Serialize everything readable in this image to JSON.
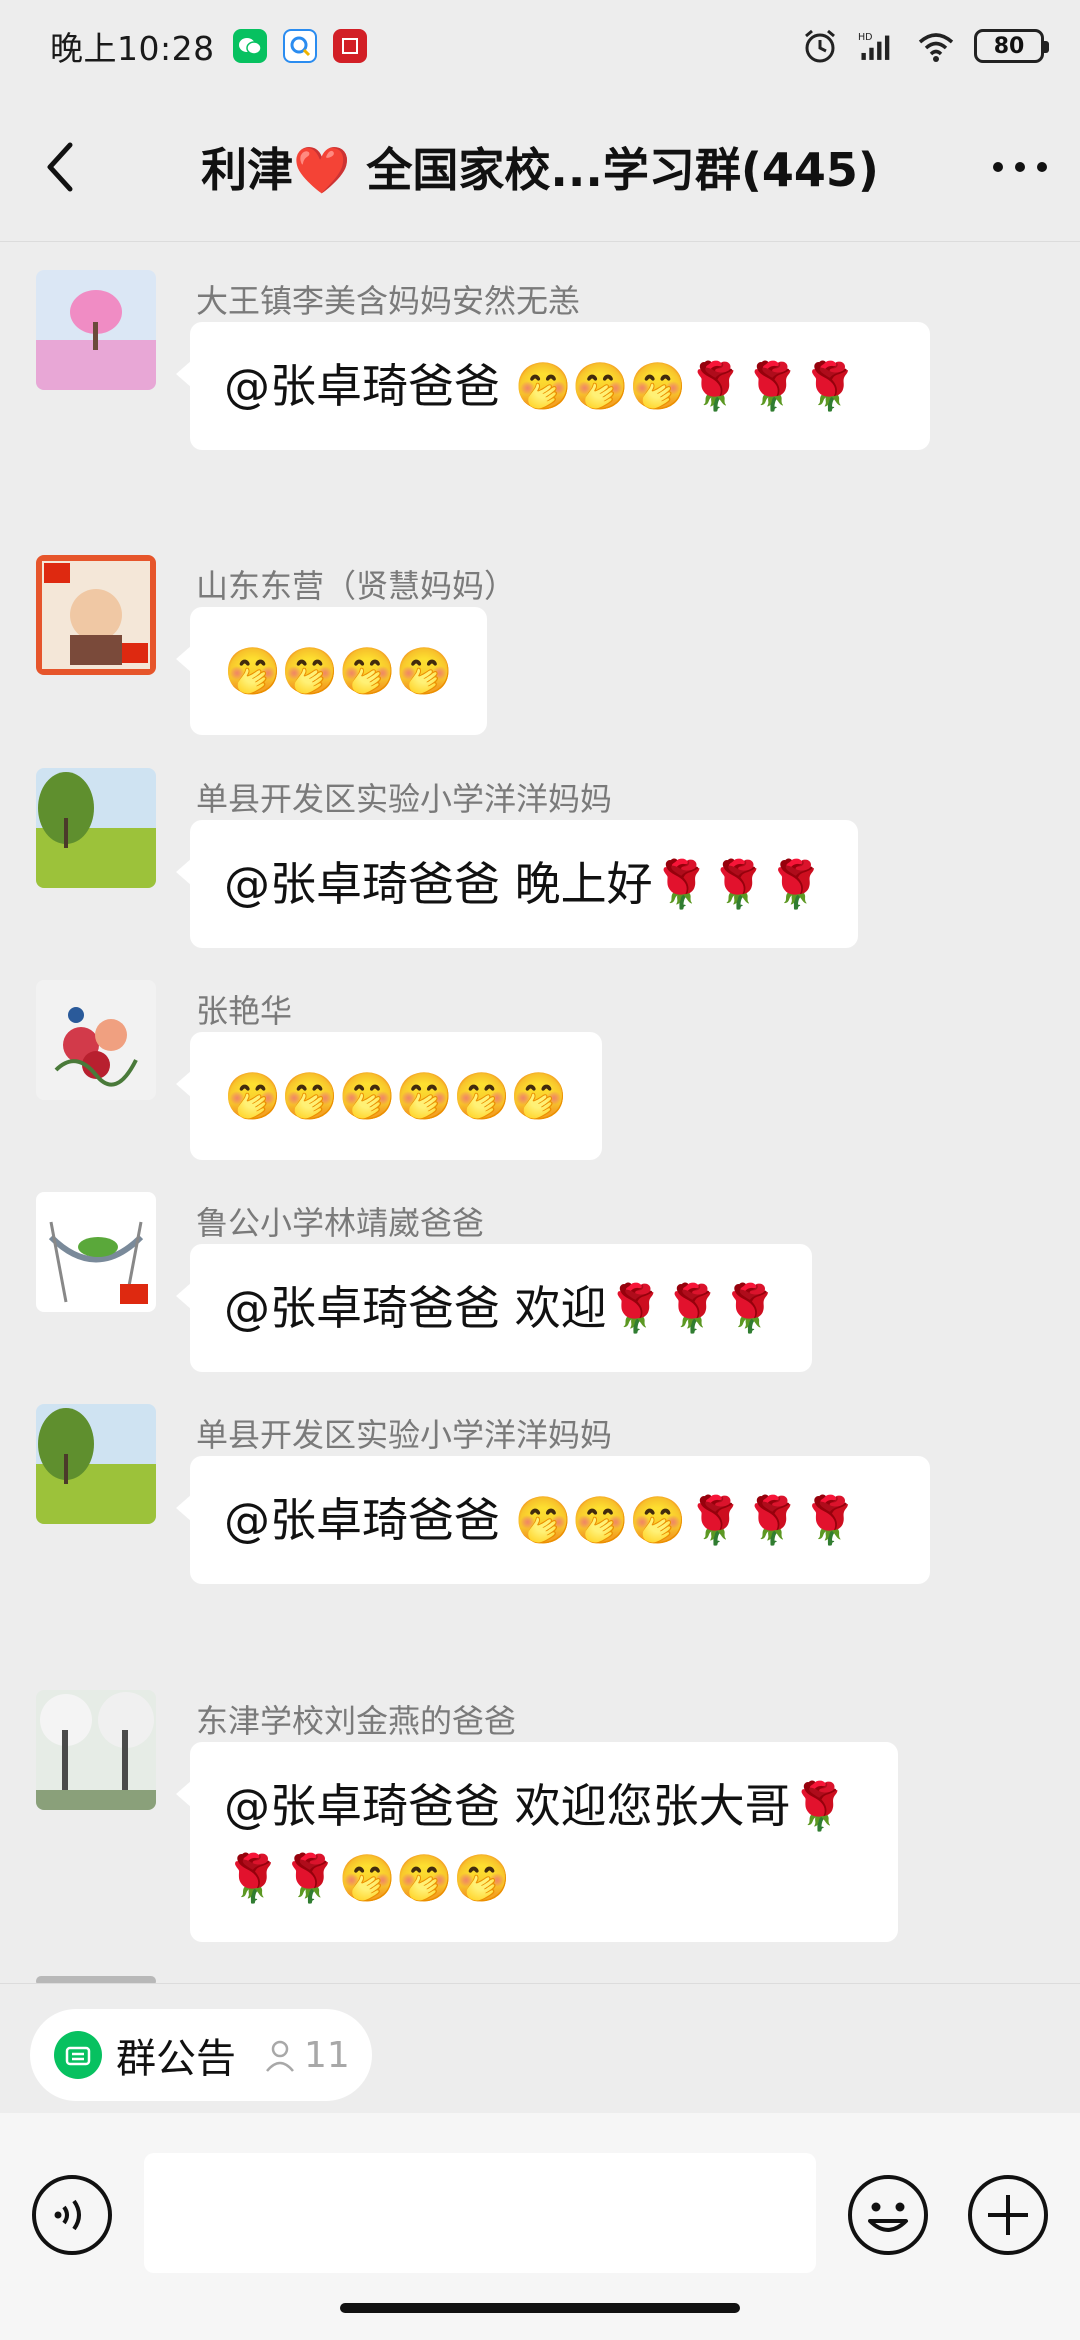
{
  "status_bar": {
    "time": "晚上10:28",
    "battery": "80",
    "signal_label": "HD"
  },
  "header": {
    "title": "利津❤️ 全国家校...学习群(445)"
  },
  "messages": [
    {
      "sender": "大王镇李美含妈妈安然无恙",
      "text": "@张卓琦爸爸  🤭🤭🤭🌹🌹🌹"
    },
    {
      "sender": "山东东营（贤慧妈妈）",
      "text": "🤭🤭🤭🤭"
    },
    {
      "sender": "单县开发区实验小学洋洋妈妈",
      "text": "@张卓琦爸爸  晚上好🌹🌹🌹"
    },
    {
      "sender": "张艳华",
      "text": "🤭🤭🤭🤭🤭🤭"
    },
    {
      "sender": "鲁公小学林靖崴爸爸",
      "text": "@张卓琦爸爸  欢迎🌹🌹🌹"
    },
    {
      "sender": "单县开发区实验小学洋洋妈妈",
      "text": "@张卓琦爸爸  🤭🤭🤭🌹🌹🌹"
    },
    {
      "sender": "东津学校刘金燕的爸爸",
      "text": "@张卓琦爸爸  欢迎您张大哥🌹🌹🌹🤭🤭🤭"
    }
  ],
  "notice": {
    "label": "群公告",
    "member_count": "11"
  },
  "input": {
    "placeholder": ""
  },
  "colors": {
    "wechat_green": "#07c160",
    "background": "#ededed",
    "bubble": "#ffffff"
  }
}
